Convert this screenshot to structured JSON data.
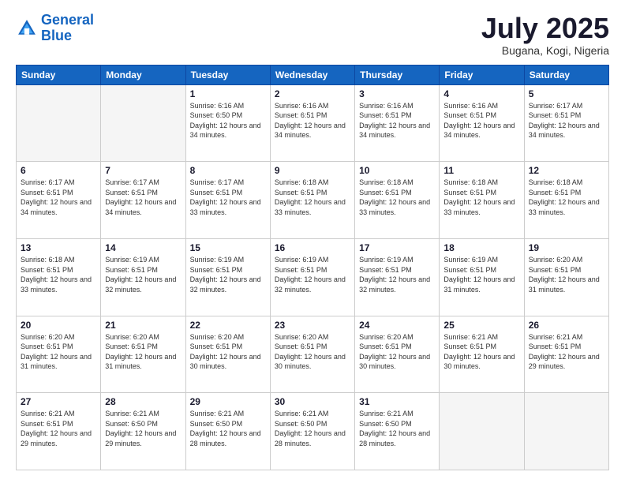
{
  "logo": {
    "line1": "General",
    "line2": "Blue"
  },
  "title": "July 2025",
  "subtitle": "Bugana, Kogi, Nigeria",
  "days_of_week": [
    "Sunday",
    "Monday",
    "Tuesday",
    "Wednesday",
    "Thursday",
    "Friday",
    "Saturday"
  ],
  "weeks": [
    [
      {
        "day": "",
        "info": ""
      },
      {
        "day": "",
        "info": ""
      },
      {
        "day": "1",
        "info": "Sunrise: 6:16 AM\nSunset: 6:50 PM\nDaylight: 12 hours and 34 minutes."
      },
      {
        "day": "2",
        "info": "Sunrise: 6:16 AM\nSunset: 6:51 PM\nDaylight: 12 hours and 34 minutes."
      },
      {
        "day": "3",
        "info": "Sunrise: 6:16 AM\nSunset: 6:51 PM\nDaylight: 12 hours and 34 minutes."
      },
      {
        "day": "4",
        "info": "Sunrise: 6:16 AM\nSunset: 6:51 PM\nDaylight: 12 hours and 34 minutes."
      },
      {
        "day": "5",
        "info": "Sunrise: 6:17 AM\nSunset: 6:51 PM\nDaylight: 12 hours and 34 minutes."
      }
    ],
    [
      {
        "day": "6",
        "info": "Sunrise: 6:17 AM\nSunset: 6:51 PM\nDaylight: 12 hours and 34 minutes."
      },
      {
        "day": "7",
        "info": "Sunrise: 6:17 AM\nSunset: 6:51 PM\nDaylight: 12 hours and 34 minutes."
      },
      {
        "day": "8",
        "info": "Sunrise: 6:17 AM\nSunset: 6:51 PM\nDaylight: 12 hours and 33 minutes."
      },
      {
        "day": "9",
        "info": "Sunrise: 6:18 AM\nSunset: 6:51 PM\nDaylight: 12 hours and 33 minutes."
      },
      {
        "day": "10",
        "info": "Sunrise: 6:18 AM\nSunset: 6:51 PM\nDaylight: 12 hours and 33 minutes."
      },
      {
        "day": "11",
        "info": "Sunrise: 6:18 AM\nSunset: 6:51 PM\nDaylight: 12 hours and 33 minutes."
      },
      {
        "day": "12",
        "info": "Sunrise: 6:18 AM\nSunset: 6:51 PM\nDaylight: 12 hours and 33 minutes."
      }
    ],
    [
      {
        "day": "13",
        "info": "Sunrise: 6:18 AM\nSunset: 6:51 PM\nDaylight: 12 hours and 33 minutes."
      },
      {
        "day": "14",
        "info": "Sunrise: 6:19 AM\nSunset: 6:51 PM\nDaylight: 12 hours and 32 minutes."
      },
      {
        "day": "15",
        "info": "Sunrise: 6:19 AM\nSunset: 6:51 PM\nDaylight: 12 hours and 32 minutes."
      },
      {
        "day": "16",
        "info": "Sunrise: 6:19 AM\nSunset: 6:51 PM\nDaylight: 12 hours and 32 minutes."
      },
      {
        "day": "17",
        "info": "Sunrise: 6:19 AM\nSunset: 6:51 PM\nDaylight: 12 hours and 32 minutes."
      },
      {
        "day": "18",
        "info": "Sunrise: 6:19 AM\nSunset: 6:51 PM\nDaylight: 12 hours and 31 minutes."
      },
      {
        "day": "19",
        "info": "Sunrise: 6:20 AM\nSunset: 6:51 PM\nDaylight: 12 hours and 31 minutes."
      }
    ],
    [
      {
        "day": "20",
        "info": "Sunrise: 6:20 AM\nSunset: 6:51 PM\nDaylight: 12 hours and 31 minutes."
      },
      {
        "day": "21",
        "info": "Sunrise: 6:20 AM\nSunset: 6:51 PM\nDaylight: 12 hours and 31 minutes."
      },
      {
        "day": "22",
        "info": "Sunrise: 6:20 AM\nSunset: 6:51 PM\nDaylight: 12 hours and 30 minutes."
      },
      {
        "day": "23",
        "info": "Sunrise: 6:20 AM\nSunset: 6:51 PM\nDaylight: 12 hours and 30 minutes."
      },
      {
        "day": "24",
        "info": "Sunrise: 6:20 AM\nSunset: 6:51 PM\nDaylight: 12 hours and 30 minutes."
      },
      {
        "day": "25",
        "info": "Sunrise: 6:21 AM\nSunset: 6:51 PM\nDaylight: 12 hours and 30 minutes."
      },
      {
        "day": "26",
        "info": "Sunrise: 6:21 AM\nSunset: 6:51 PM\nDaylight: 12 hours and 29 minutes."
      }
    ],
    [
      {
        "day": "27",
        "info": "Sunrise: 6:21 AM\nSunset: 6:51 PM\nDaylight: 12 hours and 29 minutes."
      },
      {
        "day": "28",
        "info": "Sunrise: 6:21 AM\nSunset: 6:50 PM\nDaylight: 12 hours and 29 minutes."
      },
      {
        "day": "29",
        "info": "Sunrise: 6:21 AM\nSunset: 6:50 PM\nDaylight: 12 hours and 28 minutes."
      },
      {
        "day": "30",
        "info": "Sunrise: 6:21 AM\nSunset: 6:50 PM\nDaylight: 12 hours and 28 minutes."
      },
      {
        "day": "31",
        "info": "Sunrise: 6:21 AM\nSunset: 6:50 PM\nDaylight: 12 hours and 28 minutes."
      },
      {
        "day": "",
        "info": ""
      },
      {
        "day": "",
        "info": ""
      }
    ]
  ]
}
